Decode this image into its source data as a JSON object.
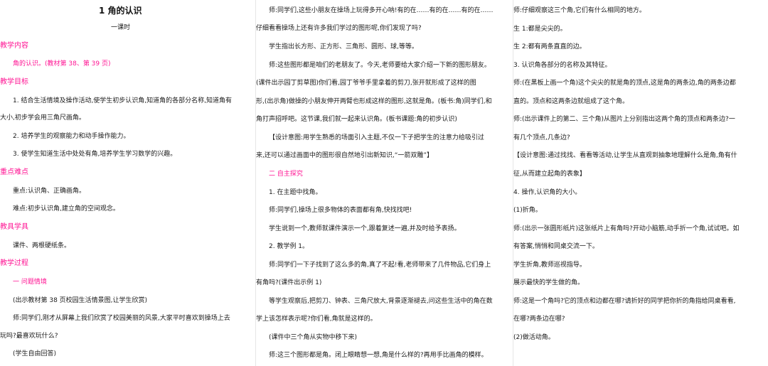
{
  "col1": {
    "title": "1 角的认识",
    "subtitle": "一课时",
    "h_content": "教学内容",
    "content_text": "角的认识。(教材第 38、第 39 页)",
    "h_goals": "教学目标",
    "goal1a": "1. 结合生活情境及操作活动,使学生初步认识角,知道角的各部分名称,知道角有",
    "goal1b": "大小,初步学会用三角尺画角。",
    "goal2": "2. 培养学生的观察能力和动手操作能力。",
    "goal3": "3. 使学生知道生活中处处有角,培养学生学习数学的兴趣。",
    "h_key": "重点难点",
    "key_point": "重点:认识角、正确画角。",
    "difficulty": "难点:初步认识角,建立角的空间观念。",
    "h_tools": "教具学具",
    "tools_text": "课件、两根硬纸条。",
    "h_process": "教学过程",
    "sec1": "一 问题情境",
    "p1": "(出示教材第 38 页校园生活情景图,让学生欣赏)",
    "p2a": "师:同学们,刚才从屏幕上我们欣赏了校园美丽的风景,大家平时喜欢到操场上去",
    "p2b": "玩吗?最喜欢玩什么?",
    "p3": "(学生自由回答)"
  },
  "col2": {
    "l1": "师:同学们,这些小朋友在操场上玩得多开心呐!有的在……有的在……有的在……",
    "l2": "仔细看看操场上还有许多我们学过的图形呢,你们发现了吗?",
    "l3": "学生指出长方形、正方形、三角形、圆形、球,等等。",
    "l4": "师:这些图形都是咱们的老朋友了。今天,老师要给大家介绍一下新的图形朋友。",
    "l5": "(课件出示园丁剪草图)你们看,园丁爷爷手里拿着的剪刀,张开就形成了这样的图",
    "l6": "形,(出示角)做操的小朋友伸开两臂也形成这样的图形,这就是角。(板书:角)同学们,和",
    "l7": "角打声招呼吧。这节课,我们就一起来认识角。(板书课题:角的初步认识)",
    "l8": "【设计意图:用学生熟悉的场面引入主题,不仅一下子把学生的注意力给吸引过",
    "l9": "来,还可以通过画面中的图形很自然地引出新知识,“一箭双雕”】",
    "sec2": "二 自主探究",
    "l10": "1. 在主题中找角。",
    "l11": "师:同学们,操场上很多物体的表面都有角,快找找吧!",
    "l12": "学生说到一个,教师就课件演示一个,跟着复述一遍,并及时给予表扬。",
    "l13": "2. 教学例 1。",
    "l14": "师:同学们一下子找到了这么多的角,真了不起!看,老师带来了几件物品,它们身上",
    "l15": "有角吗?(课件出示例 1)",
    "l16": "等学生观察后,把剪刀、钟表、三角尺放大,背景逐渐褪去,问这些生活中的角在数",
    "l17": "学上该怎样表示呢?你们看,角就是这样的。",
    "l18": "(课件中三个角从实物中移下来)",
    "l19": "师:这三个图形都是角。闭上眼睛想一想,角是什么样的?再用手比画角的模样。"
  },
  "col3": {
    "l1": "师:仔细观察这三个角,它们有什么相同的地方。",
    "l2": "生 1:都是尖尖的。",
    "l3": "生 2:都有两条直直的边。",
    "l4": "3. 认识角各部分的名称及其特征。",
    "l5": "师:(在黑板上画一个角)这个尖尖的就是角的顶点,这是角的两条边,角的两条边都",
    "l6": "是直直的。顶点和这两条边就组成了这个角。",
    "l7": "师:(出示课件上的第二、三个角)从图片上分别指出这两个角的顶点和两条边?一",
    "l8": "个角有几个顶点,几条边?",
    "l9": "【设计意图:通过找找、看看等活动,让学生从直观到抽象地理解什么是角,角有什",
    "l10": "么特征,从而建立起角的表象】",
    "l11": "4. 操作,认识角的大小。",
    "l12": "(1)折角。",
    "l13": "师:(出示一张圆形纸片)这张纸片上有角吗?开动小脑筋,动手折一个角,试试吧。如",
    "l14": "果你有答案,悄悄和同桌交流一下。",
    "l15": "学生折角,教师巡视指导。",
    "l16": "展示最快的学生做的角。",
    "l17": "师:这是一个角吗?它的顶点和边都在哪?请折好的同学把你折的角指给同桌看看,",
    "l18": "顶点在哪?两条边在哪?",
    "l19": "(2)做活动角。"
  }
}
